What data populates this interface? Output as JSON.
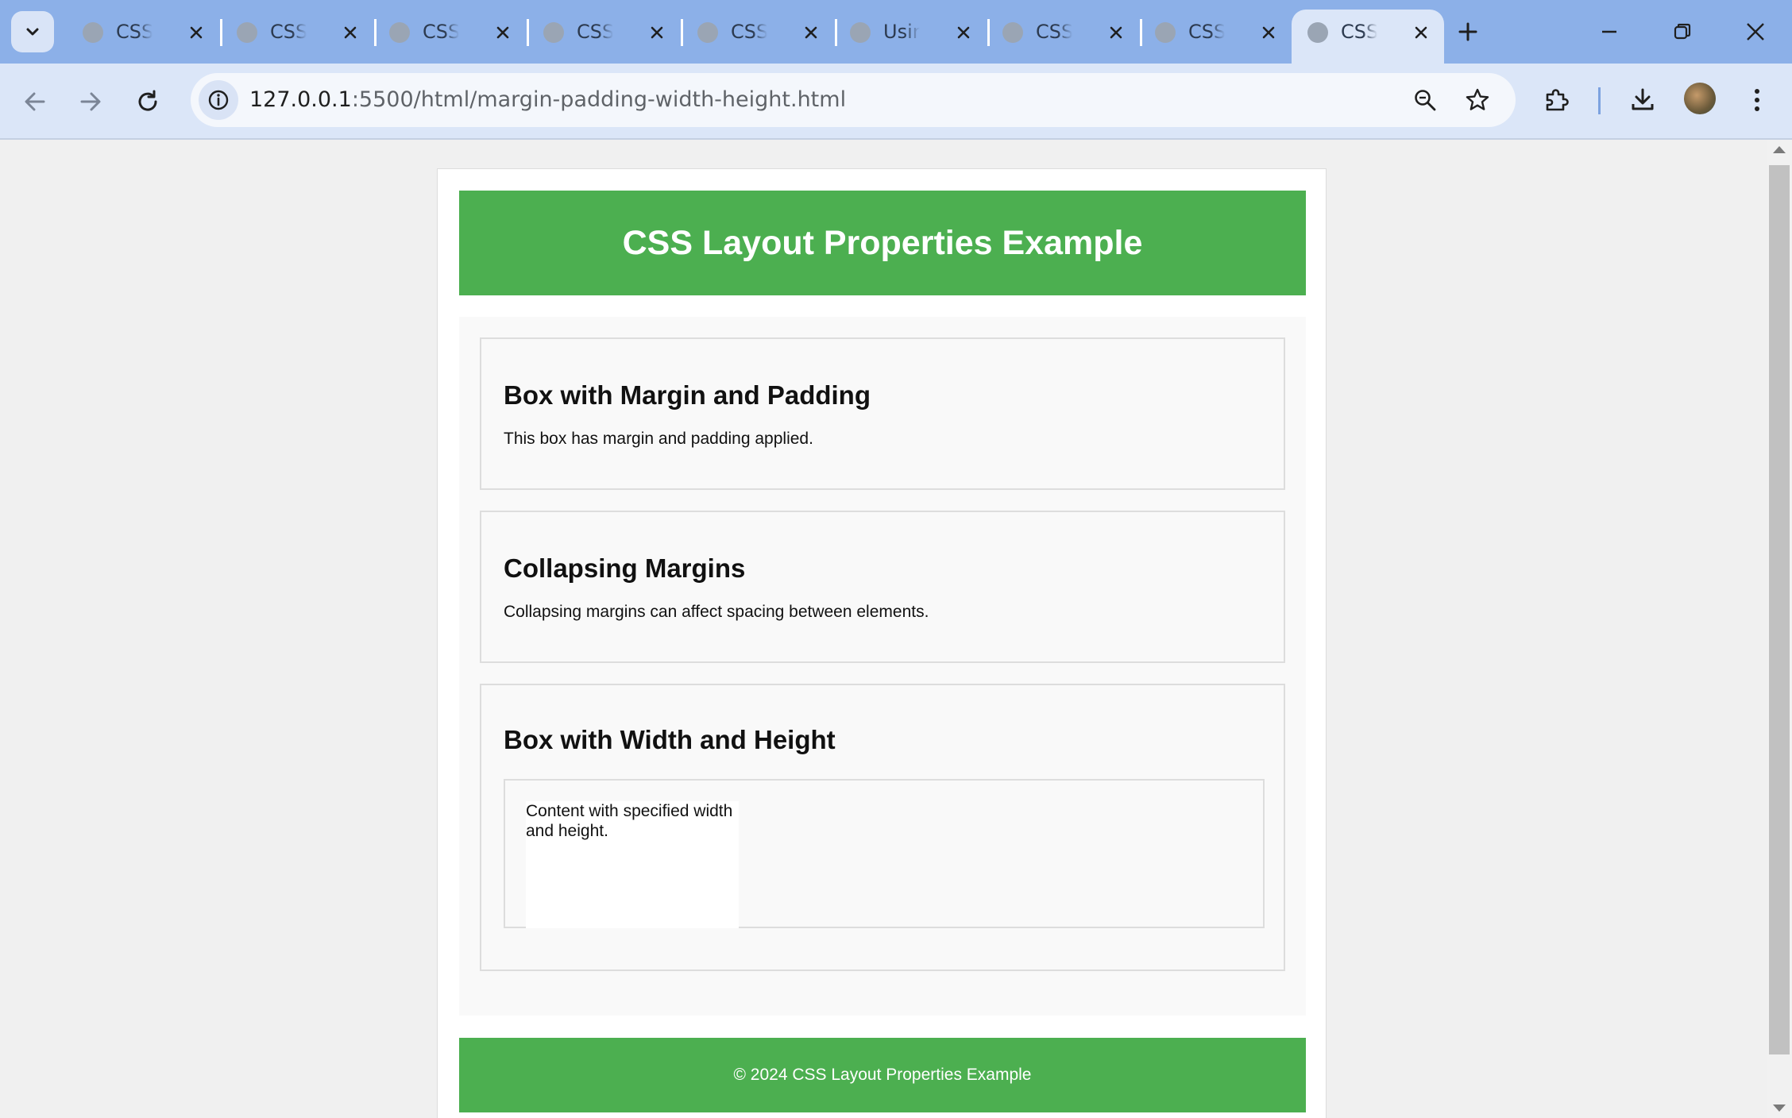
{
  "browser": {
    "tabs": [
      {
        "title": "CSS S",
        "active": false
      },
      {
        "title": "CSS U",
        "active": false
      },
      {
        "title": "CSS S",
        "active": false
      },
      {
        "title": "CSS S",
        "active": false
      },
      {
        "title": "CSS C",
        "active": false
      },
      {
        "title": "Using",
        "active": false
      },
      {
        "title": "CSS I",
        "active": false
      },
      {
        "title": "CSS I",
        "active": false
      },
      {
        "title": "CSS I",
        "active": true
      }
    ],
    "url_host": "127.0.0.1",
    "url_rest": ":5500/html/margin-padding-width-height.html",
    "icons": [
      "tab-search-icon",
      "favicon-globe-icon",
      "close-icon",
      "new-tab-icon",
      "minimize-icon",
      "restore-icon",
      "window-close-icon",
      "back-arrow-icon",
      "forward-arrow-icon",
      "reload-icon",
      "site-info-icon",
      "zoom-icon",
      "bookmark-star-icon",
      "extensions-icon",
      "download-icon",
      "profile-avatar",
      "more-menu-icon"
    ],
    "colors": {
      "tabbar": "#8cb0e8",
      "toolbar": "#dbe6f8",
      "accent_green": "#4caf50"
    }
  },
  "page": {
    "header_title": "CSS Layout Properties Example",
    "sections": [
      {
        "heading": "Box with Margin and Padding",
        "text": "This box has margin and padding applied."
      },
      {
        "heading": "Collapsing Margins",
        "text": "Collapsing margins can affect spacing between elements."
      },
      {
        "heading": "Box with Width and Height",
        "text": "Content with specified width and height."
      }
    ],
    "footer_text": "© 2024 CSS Layout Properties Example"
  }
}
